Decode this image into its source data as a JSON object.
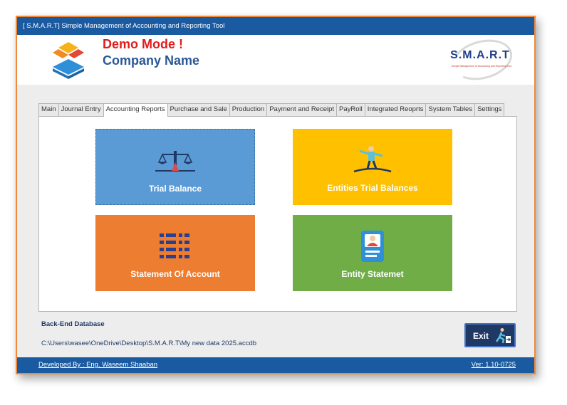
{
  "window": {
    "title": "[ S.M.A.R.T] Simple Management of Accounting and Reporting Tool"
  },
  "header": {
    "demo_mode": "Demo Mode !",
    "company_name": "Company Name",
    "brand_logo_text": "S.M.A.R.T",
    "brand_logo_subtitle": "Simple Management of Accounting and Reporting Tool"
  },
  "tabs": [
    {
      "label": "Main",
      "active": false
    },
    {
      "label": "Journal Entry",
      "active": false
    },
    {
      "label": "Accounting Reports",
      "active": true
    },
    {
      "label": "Purchase and Sale",
      "active": false
    },
    {
      "label": "Production",
      "active": false
    },
    {
      "label": "Payment and Receipt",
      "active": false
    },
    {
      "label": "PayRoll",
      "active": false
    },
    {
      "label": "Integrated Reoprts",
      "active": false
    },
    {
      "label": "System Tables",
      "active": false
    },
    {
      "label": "Settings",
      "active": false
    }
  ],
  "tiles": {
    "trial_balance": {
      "label": "Trial Balance",
      "icon": "scales-icon",
      "color": "#5b9bd5"
    },
    "entities_trial_balances": {
      "label": "Entities Trial Balances",
      "icon": "balance-person-icon",
      "color": "#ffc000"
    },
    "statement_of_account": {
      "label": "Statement Of Account",
      "icon": "list-icon",
      "color": "#ed7d31"
    },
    "entity_statement": {
      "label": "Entity Statemet",
      "icon": "id-card-icon",
      "color": "#70ad47"
    }
  },
  "backend": {
    "label": "Back-End Database",
    "path": "C:\\Users\\wasee\\OneDrive\\Desktop\\S.M.A.R.T\\My new data 2025.accdb"
  },
  "exit_button": {
    "label": "Exit",
    "icon": "running-exit-icon"
  },
  "footer": {
    "developer": "Developed By : Eng. Waseem Shaaban",
    "version": "Ver: 1.10-0725"
  },
  "colors": {
    "titlebar": "#1a5aa0",
    "window_border": "#ef8a3a",
    "demo_mode": "#e31c1c",
    "company_name": "#2b5797",
    "exit_button": "#1f3864"
  }
}
